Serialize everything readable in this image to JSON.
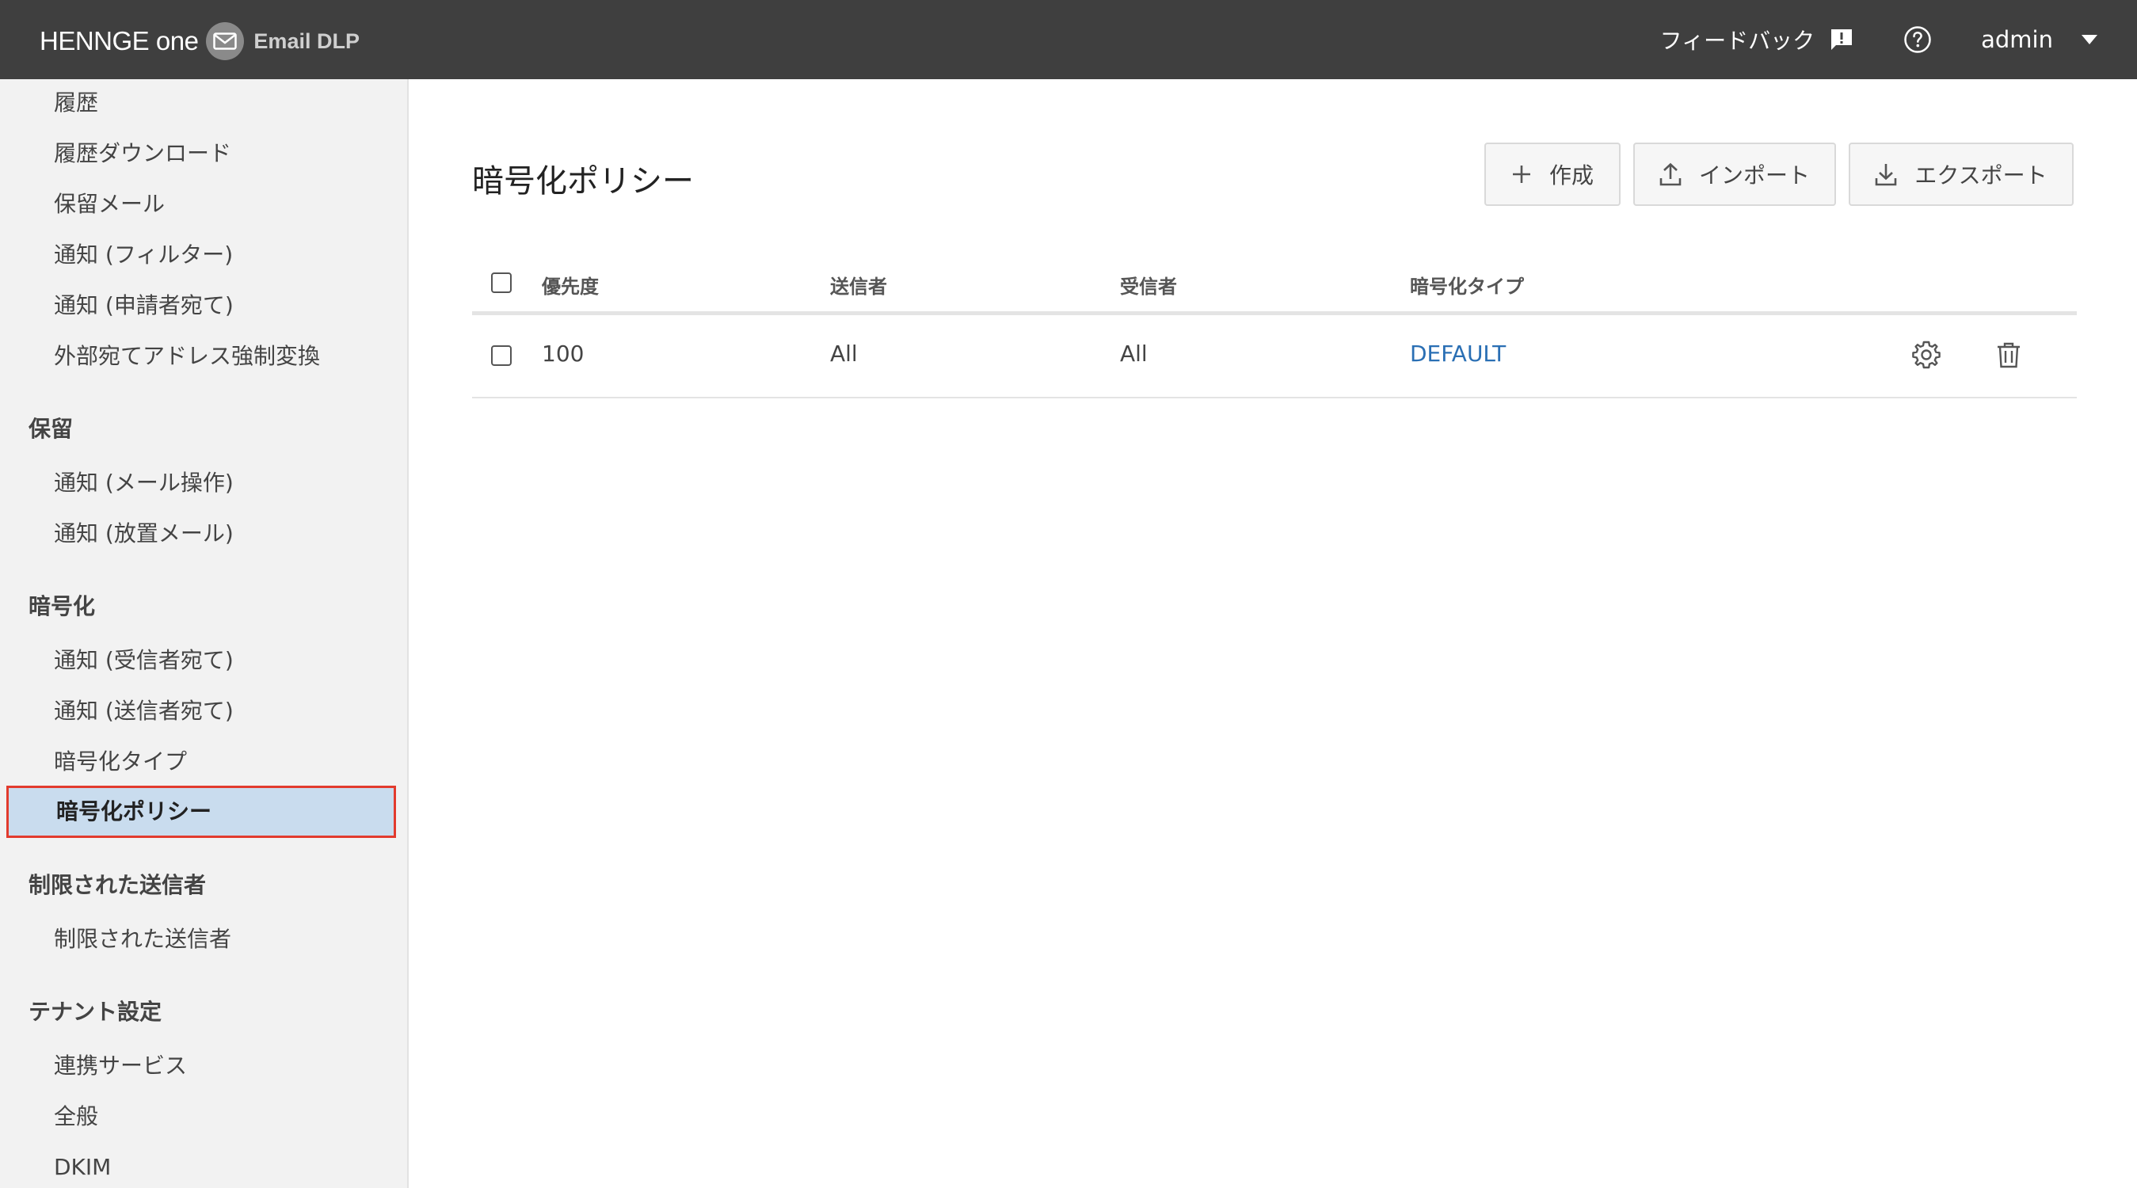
{
  "header": {
    "brand_main": "HENNGE",
    "brand_one": "one",
    "product": "Email DLP",
    "feedback_label": "フィードバック",
    "user_label": "admin"
  },
  "sidebar": {
    "items": [
      {
        "type": "item",
        "label": "履歴"
      },
      {
        "type": "item",
        "label": "履歴ダウンロード"
      },
      {
        "type": "item",
        "label": "保留メール"
      },
      {
        "type": "item",
        "label": "通知 (フィルター)"
      },
      {
        "type": "item",
        "label": "通知 (申請者宛て)"
      },
      {
        "type": "item",
        "label": "外部宛てアドレス強制変換"
      },
      {
        "type": "heading",
        "label": "保留"
      },
      {
        "type": "item",
        "label": "通知 (メール操作)"
      },
      {
        "type": "item",
        "label": "通知 (放置メール)"
      },
      {
        "type": "heading",
        "label": "暗号化"
      },
      {
        "type": "item",
        "label": "通知 (受信者宛て)"
      },
      {
        "type": "item",
        "label": "通知 (送信者宛て)"
      },
      {
        "type": "item",
        "label": "暗号化タイプ"
      },
      {
        "type": "active",
        "label": "暗号化ポリシー"
      },
      {
        "type": "heading",
        "label": "制限された送信者"
      },
      {
        "type": "item",
        "label": "制限された送信者"
      },
      {
        "type": "heading",
        "label": "テナント設定"
      },
      {
        "type": "item",
        "label": "連携サービス"
      },
      {
        "type": "item",
        "label": "全般"
      },
      {
        "type": "item",
        "label": "DKIM"
      }
    ]
  },
  "main": {
    "title": "暗号化ポリシー",
    "buttons": {
      "create": "作成",
      "import": "インポート",
      "export": "エクスポート"
    },
    "table": {
      "columns": [
        "優先度",
        "送信者",
        "受信者",
        "暗号化タイプ"
      ],
      "rows": [
        {
          "priority": "100",
          "sender": "All",
          "recipient": "All",
          "encryption_type": "DEFAULT"
        }
      ]
    }
  },
  "colors": {
    "header_bg": "#3f3f3f",
    "sidebar_bg": "#f2f2f2",
    "active_bg": "#c9dcee",
    "active_border": "#e23b2e",
    "link": "#2a6fb4"
  }
}
